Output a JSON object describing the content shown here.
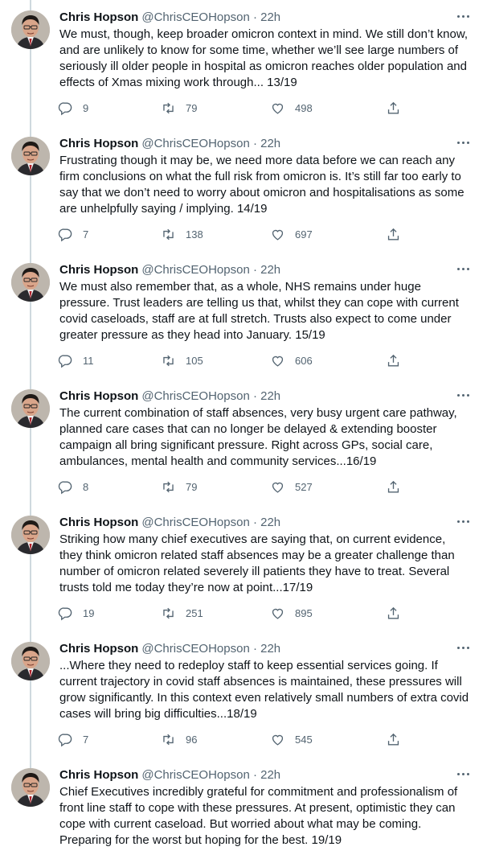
{
  "tweets": [
    {
      "name": "Chris Hopson",
      "handle": "@ChrisCEOHopson",
      "separator": "·",
      "time": "22h",
      "text": "We must, though, keep broader omicron context in mind. We still don’t know, and are unlikely to know for some time, whether we’ll see large numbers of seriously ill older people in hospital as omicron reaches older population and effects of Xmas mixing work through... 13/19",
      "replies": "9",
      "retweets": "79",
      "likes": "498"
    },
    {
      "name": "Chris Hopson",
      "handle": "@ChrisCEOHopson",
      "separator": "·",
      "time": "22h",
      "text": "Frustrating though it may be, we need more data before we can reach any firm conclusions on what the full risk from omicron is. It’s still far too early to say that we don’t need to worry about omicron and hospitalisations as some are unhelpfully saying / implying. 14/19",
      "replies": "7",
      "retweets": "138",
      "likes": "697"
    },
    {
      "name": "Chris Hopson",
      "handle": "@ChrisCEOHopson",
      "separator": "·",
      "time": "22h",
      "text": "We must also remember that, as a whole, NHS remains under huge pressure. Trust leaders are telling us that, whilst they can cope with current covid caseloads, staff are at full stretch. Trusts also expect to come under greater pressure as they head into January. 15/19",
      "replies": "11",
      "retweets": "105",
      "likes": "606"
    },
    {
      "name": "Chris Hopson",
      "handle": "@ChrisCEOHopson",
      "separator": "·",
      "time": "22h",
      "text": "The current combination of staff absences, very busy urgent care pathway, planned care cases that can no longer be delayed & extending booster campaign all bring significant pressure. Right across GPs, social care, ambulances, mental health and community services...16/19",
      "replies": "8",
      "retweets": "79",
      "likes": "527"
    },
    {
      "name": "Chris Hopson",
      "handle": "@ChrisCEOHopson",
      "separator": "·",
      "time": "22h",
      "text": "Striking how many chief executives are saying that, on current evidence, they think omicron related staff absences may be a greater challenge than number of omicron related severely ill patients they have to treat. Several trusts told me today they’re now at point...17/19",
      "replies": "19",
      "retweets": "251",
      "likes": "895"
    },
    {
      "name": "Chris Hopson",
      "handle": "@ChrisCEOHopson",
      "separator": "·",
      "time": "22h",
      "text": "...Where they need to redeploy staff to keep essential services going. If current trajectory in covid staff absences is maintained, these pressures will grow significantly. In this context even relatively small numbers of extra covid cases will bring big difficulties...18/19",
      "replies": "7",
      "retweets": "96",
      "likes": "545"
    },
    {
      "name": "Chris Hopson",
      "handle": "@ChrisCEOHopson",
      "separator": "·",
      "time": "22h",
      "text": "Chief Executives incredibly grateful for commitment and professionalism of front line staff to cope with these pressures. At present, optimistic they can cope with current caseload. But worried about what may be coming. Preparing for the worst but hoping for the best. 19/19"
    }
  ],
  "icons": {
    "reply": "reply-icon",
    "retweet": "retweet-icon",
    "like": "heart-icon",
    "share": "share-icon",
    "more": "more-icon"
  },
  "colors": {
    "text": "#0f1419",
    "secondary": "#536471",
    "thread_line": "#cfd9de",
    "background": "#ffffff"
  }
}
